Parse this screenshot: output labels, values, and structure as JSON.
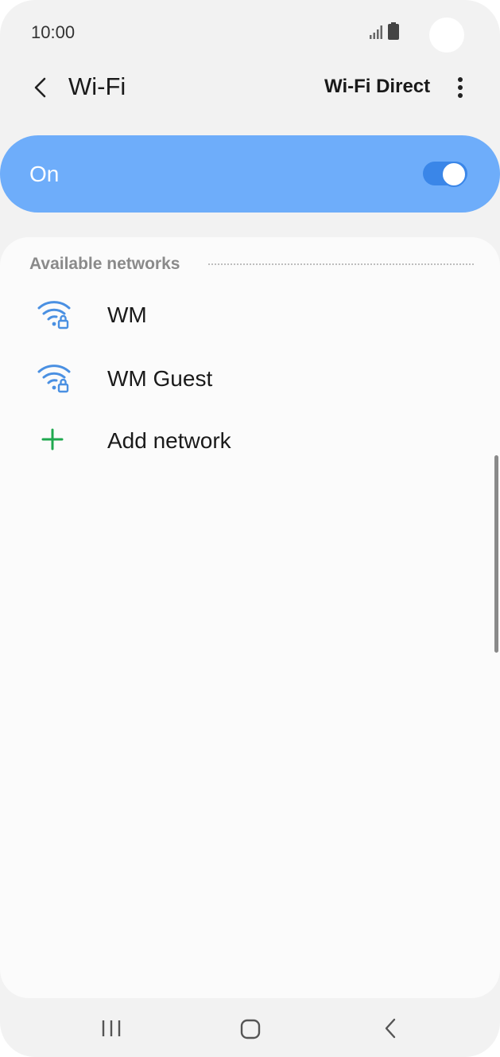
{
  "status_bar": {
    "time": "10:00"
  },
  "app_bar": {
    "title": "Wi-Fi",
    "action_label": "Wi-Fi Direct"
  },
  "master_switch": {
    "label": "On",
    "state": "on"
  },
  "networks_section": {
    "header": "Available networks",
    "networks": [
      {
        "name": "WM",
        "icon": "wifi-lock-icon"
      },
      {
        "name": "WM Guest",
        "icon": "wifi-lock-icon"
      }
    ],
    "add_network_label": "Add network"
  },
  "colors": {
    "accent": "#3a86e8",
    "switch_background": "#6eadfa",
    "wifi_icon": "#4a90e2",
    "add_icon": "#1fa84f"
  }
}
